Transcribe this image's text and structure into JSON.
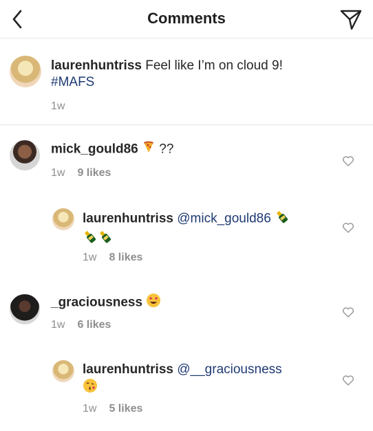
{
  "header": {
    "title": "Comments",
    "back_icon": "chevron-left-icon",
    "send_icon": "send-direct-icon"
  },
  "caption": {
    "username": "laurenhuntriss",
    "text": " Feel like I’m on cloud 9!",
    "hashtag": "#MAFS",
    "time": "1w"
  },
  "comments": [
    {
      "username": "mick_gould86",
      "text": " ??",
      "emoji": "pizza",
      "time": "1w",
      "likes": "9 likes"
    },
    {
      "username": "laurenhuntriss",
      "mention": "@mick_gould86",
      "emoji": "champagne bottles",
      "time": "1w",
      "likes": "8 likes"
    },
    {
      "username": "_graciousness",
      "emoji": "heart-eyes face",
      "time": "1w",
      "likes": "6 likes"
    },
    {
      "username": "laurenhuntriss",
      "mention": "@__graciousness",
      "emoji": "face blowing a kiss",
      "time": "1w",
      "likes": "5 likes"
    }
  ],
  "colors": {
    "text": "#262626",
    "link": "#1e3a72",
    "muted": "#8e8e8e",
    "divider": "#e6e6e6"
  }
}
